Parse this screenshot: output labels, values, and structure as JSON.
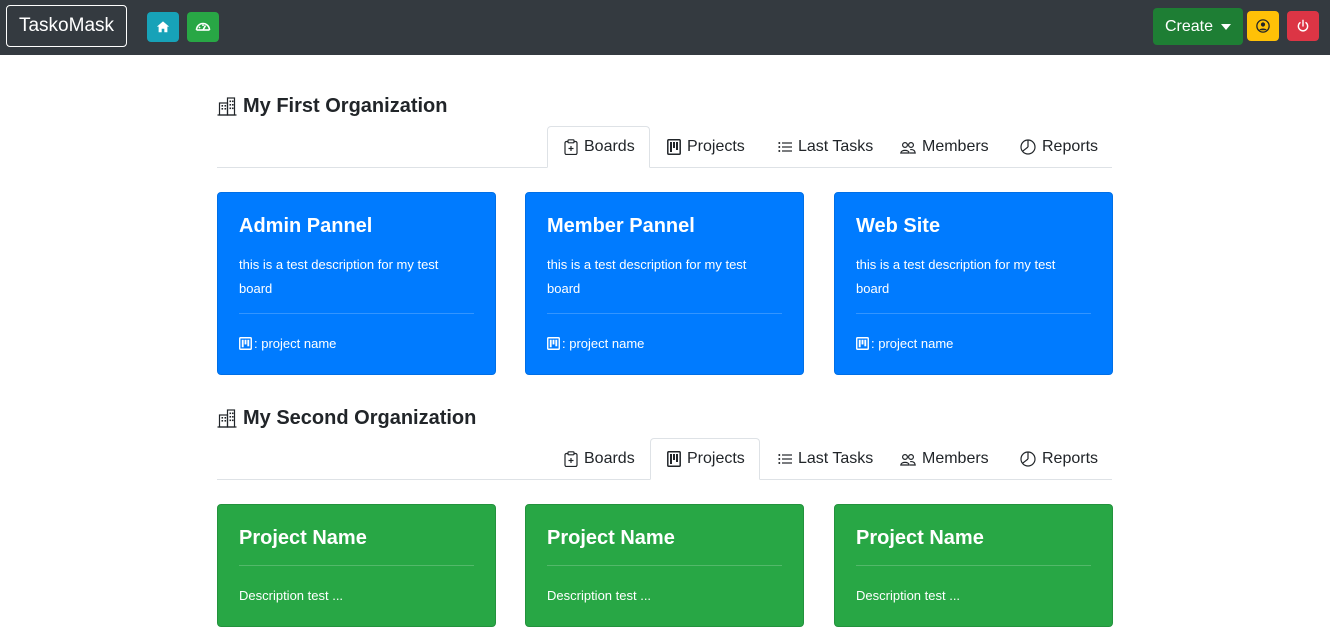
{
  "navbar": {
    "brand": "TaskoMask",
    "create_label": "Create",
    "icons": [
      "home-icon",
      "dashboard-icon",
      "user-icon",
      "power-icon"
    ],
    "colors": {
      "bg": "#343a40",
      "home": "#17a2b8",
      "dashboard": "#28a745",
      "create": "#1e7e34",
      "user": "#ffc107",
      "power": "#dc3545"
    }
  },
  "organizations": [
    {
      "title": "My First Organization",
      "tabs": [
        {
          "label": "Boards",
          "icon": "clipboard-icon",
          "active": true
        },
        {
          "label": "Projects",
          "icon": "kanban-icon",
          "active": false
        },
        {
          "label": "Last Tasks",
          "icon": "list-icon",
          "active": false
        },
        {
          "label": "Members",
          "icon": "people-icon",
          "active": false
        },
        {
          "label": "Reports",
          "icon": "pie-chart-icon",
          "active": false
        }
      ],
      "cards": [
        {
          "title": "Admin Pannel",
          "description": "this is a test description for my test board",
          "footer": ": project name"
        },
        {
          "title": "Member Pannel",
          "description": "this is a test description for my test board",
          "footer": ": project name"
        },
        {
          "title": "Web Site",
          "description": "this is a test description for my test board",
          "footer": ": project name"
        }
      ],
      "card_color": "#007bff"
    },
    {
      "title": "My Second Organization",
      "tabs": [
        {
          "label": "Boards",
          "icon": "clipboard-icon",
          "active": false
        },
        {
          "label": "Projects",
          "icon": "kanban-icon",
          "active": true
        },
        {
          "label": "Last Tasks",
          "icon": "list-icon",
          "active": false
        },
        {
          "label": "Members",
          "icon": "people-icon",
          "active": false
        },
        {
          "label": "Reports",
          "icon": "pie-chart-icon",
          "active": false
        }
      ],
      "cards": [
        {
          "title": "Project Name",
          "description": "Description test ..."
        },
        {
          "title": "Project Name",
          "description": "Description test ..."
        },
        {
          "title": "Project Name",
          "description": "Description test ..."
        }
      ],
      "card_color": "#28a745"
    }
  ]
}
